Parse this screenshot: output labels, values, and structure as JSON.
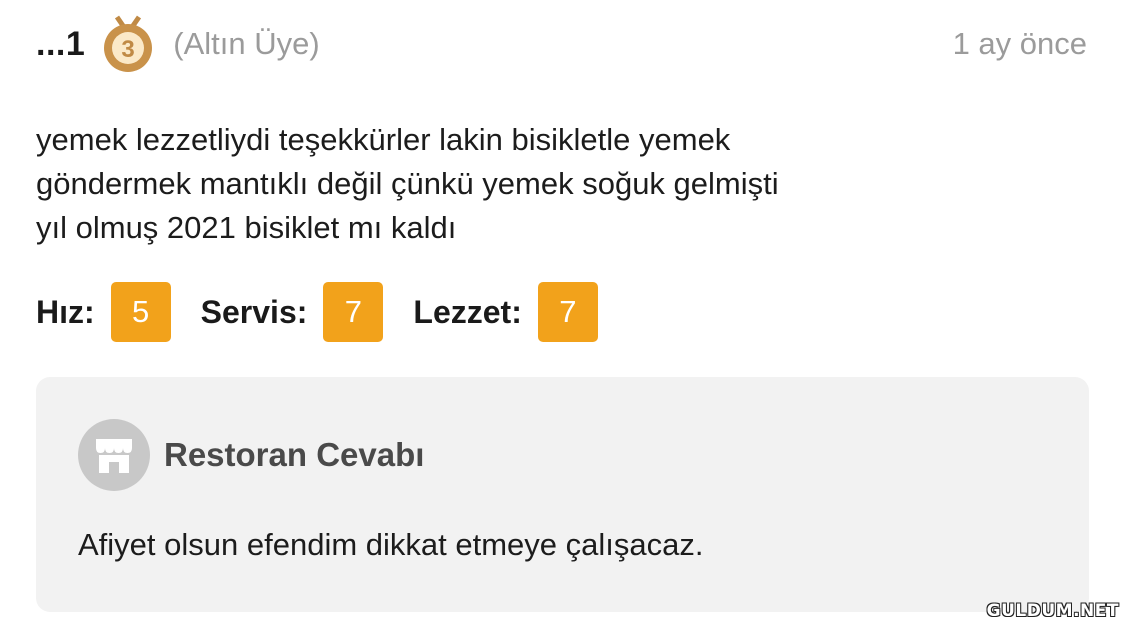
{
  "header": {
    "username": "...1",
    "medal_icon": "bronze-medal-icon",
    "medal_number": "3",
    "member_level": "(Altın Üye)",
    "time_ago": "1 ay önce"
  },
  "review": {
    "lines": [
      "yemek lezzetliydi teşekkürler lakin bisikletle yemek",
      "göndermek mantıklı değil çünkü yemek soğuk gelmişti",
      "yıl olmuş 2021 bisiklet mı kaldı"
    ]
  },
  "ratings": [
    {
      "label": "Hız:",
      "value": "5"
    },
    {
      "label": "Servis:",
      "value": "7"
    },
    {
      "label": "Lezzet:",
      "value": "7"
    }
  ],
  "reply": {
    "icon": "store-icon",
    "title": "Restoran Cevabı",
    "text": "Afiyet olsun efendim dikkat etmeye çalışacaz."
  },
  "watermark": "GULDUM.NET",
  "colors": {
    "rating_badge": "#f2a21b",
    "reply_background": "#f2f2f2",
    "muted_text": "#9b9b9b",
    "medal": "#c9924a"
  }
}
